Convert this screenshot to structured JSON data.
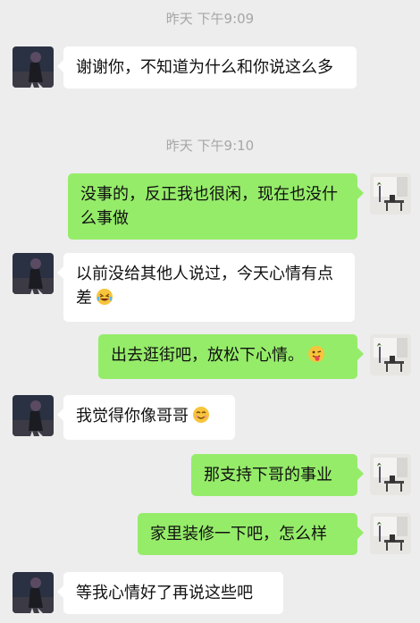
{
  "timestamps": [
    "昨天 下午9:09",
    "昨天 下午9:10"
  ],
  "messages": [
    {
      "side": "in",
      "text": "谢谢你，不知道为什么和你说这么多"
    },
    {
      "side": "out",
      "text": "没事的，反正我也很闲，现在也没什么事做"
    },
    {
      "side": "in",
      "text": "以前没给其他人说过，今天心情有点差",
      "emoji": "laughing-tears-emoji"
    },
    {
      "side": "out",
      "text": "出去逛街吧，放松下心情。",
      "emoji": "winking-tongue-emoji"
    },
    {
      "side": "in",
      "text": "我觉得你像哥哥",
      "emoji": "smiling-emoji"
    },
    {
      "side": "out",
      "text": "那支持下哥的事业"
    },
    {
      "side": "out",
      "text": "家里装修一下吧，怎么样"
    },
    {
      "side": "in",
      "text": "等我心情好了再说这些吧"
    }
  ],
  "colors": {
    "background": "#ededed",
    "incoming_bubble": "#ffffff",
    "outgoing_bubble": "#95ec69",
    "timestamp": "#a6a6a6"
  }
}
